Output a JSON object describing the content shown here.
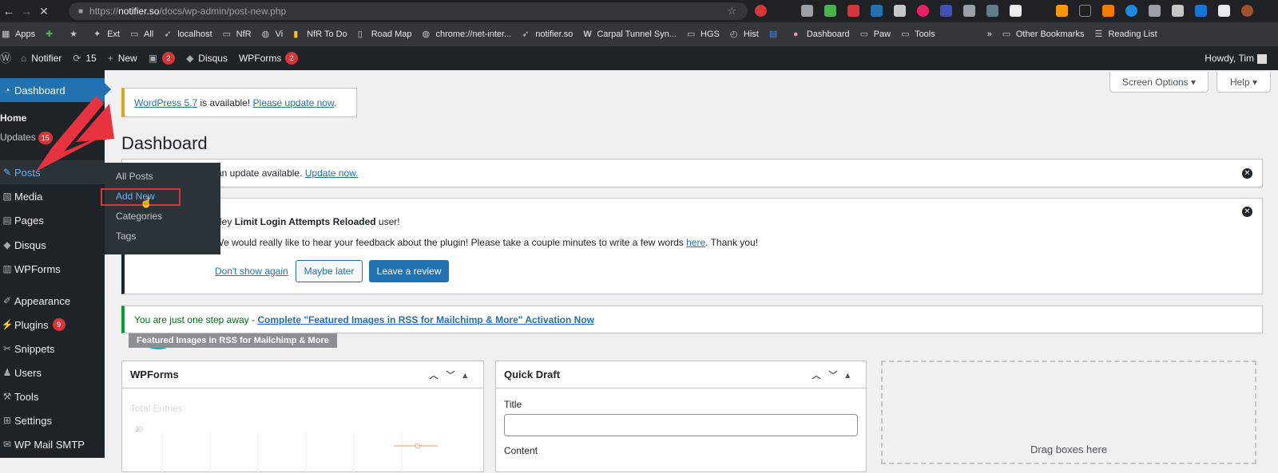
{
  "browser": {
    "url_scheme": "https://",
    "url_host": "notifier.so",
    "url_path": "/docs/wp-admin/post-new.php",
    "bookmarks": [
      "Apps",
      "Ext",
      "All",
      "localhost",
      "NfR",
      "Vi",
      "NfR To Do",
      "Road Map",
      "chrome://net-inter...",
      "notifier.so",
      "Carpal Tunnel Syn...",
      "HGS",
      "Hist",
      "Dashboard",
      "Paw",
      "Tools"
    ],
    "overflow_label": "»",
    "other_bookmarks": "Other Bookmarks",
    "reading_list": "Reading List"
  },
  "adminbar": {
    "site_name": "Notifier",
    "updates_count": "15",
    "new_label": "New",
    "comments_count": "2",
    "disqus_label": "Disqus",
    "wpforms_label": "WPForms",
    "wpforms_count": "2",
    "howdy": "Howdy, Tim"
  },
  "sidebar": {
    "dashboard": "Dashboard",
    "home": "Home",
    "updates": "Updates",
    "updates_count": "15",
    "posts": "Posts",
    "media": "Media",
    "pages": "Pages",
    "disqus": "Disqus",
    "wpforms": "WPForms",
    "appearance": "Appearance",
    "plugins": "Plugins",
    "plugins_count": "9",
    "snippets": "Snippets",
    "users": "Users",
    "tools": "Tools",
    "settings": "Settings",
    "wp_mail_smtp": "WP Mail SMTP"
  },
  "flyout": {
    "all_posts": "All Posts",
    "add_new": "Add New",
    "categories": "Categories",
    "tags": "Tags"
  },
  "header": {
    "screen_options": "Screen Options ▾",
    "help": "Help ▾",
    "title": "Dashboard"
  },
  "notices": {
    "wp_version": "WordPress 5.7",
    "wp_available": " is available! ",
    "wp_update_link": "Please update now",
    "wp_period": ".",
    "plugin_update_text": "an update available.",
    "plugin_update_link": "Update now.",
    "llar_hey": "Hey ",
    "llar_name": "Limit Login Attempts Reloaded",
    "llar_user": " user!",
    "llar_body": "We would really like to hear your feedback about the plugin! Please take a couple minutes to write a few words ",
    "llar_here": "here",
    "llar_thanks": ". Thank you!",
    "dont_show": "Don't show again",
    "maybe_later": "Maybe later",
    "leave_review": "Leave a review",
    "rss_prefix": "You are just one step away - ",
    "rss_link": "Complete \"Featured Images in RSS for Mailchimp & More\" Activation Now",
    "rss_tag": "Featured Images in RSS for Mailchimp & More"
  },
  "widgets": {
    "wpforms_title": "WPForms",
    "total_entries": "Total Entries",
    "y_tick": "20",
    "quick_draft_title": "Quick Draft",
    "title_label": "Title",
    "content_label": "Content",
    "drag_boxes": "Drag boxes here"
  }
}
